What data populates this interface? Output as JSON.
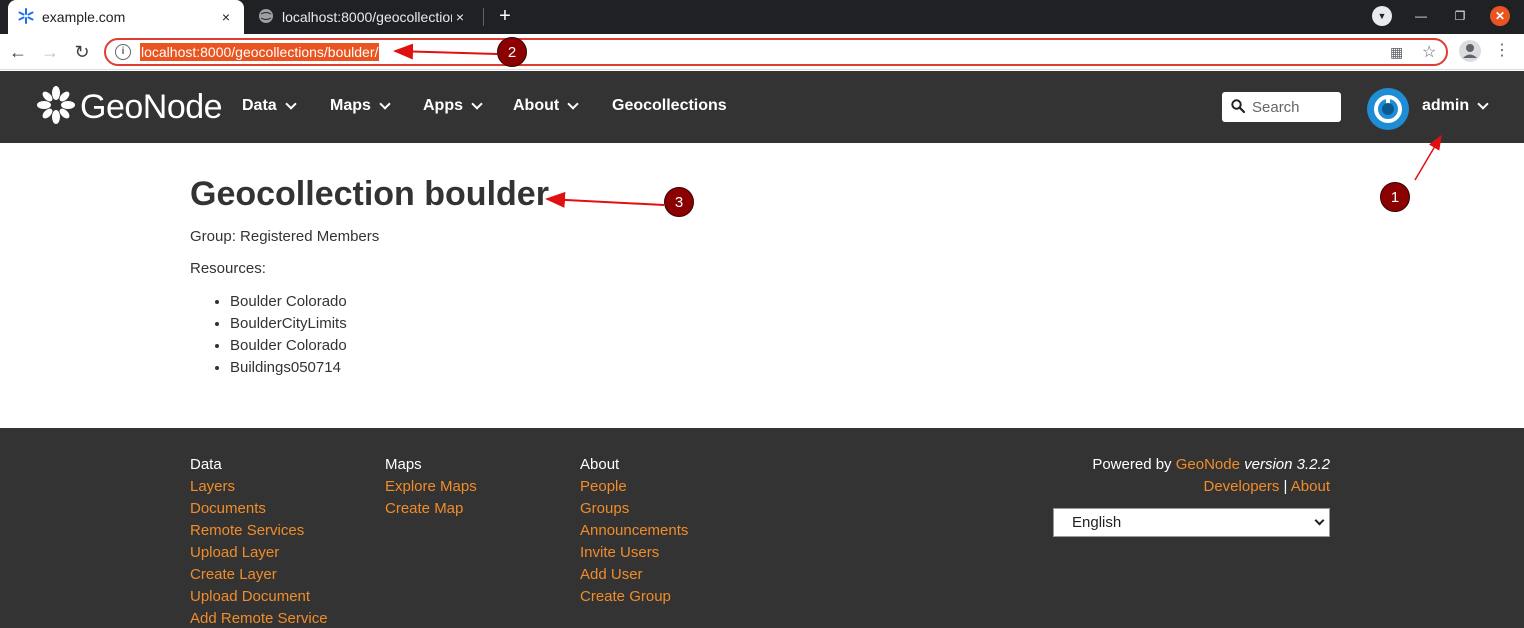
{
  "browser": {
    "tabs": [
      {
        "title": "example.com",
        "close": "×"
      },
      {
        "title": "localhost:8000/geocollections/boulder/",
        "close": "×"
      }
    ],
    "new_tab": "+",
    "url": "localhost:8000/geocollections/boulder/"
  },
  "site": {
    "logo_text": "GeoNode",
    "nav": [
      {
        "label": "Data"
      },
      {
        "label": "Maps"
      },
      {
        "label": "Apps"
      },
      {
        "label": "About"
      },
      {
        "label": "Geocollections"
      }
    ],
    "search_placeholder": "Search",
    "username": "admin"
  },
  "main": {
    "title": "Geocollection boulder",
    "group_line": "Group: Registered Members",
    "resources_heading": "Resources:",
    "resources": [
      "Boulder Colorado",
      "BoulderCityLimits",
      "Boulder Colorado",
      "Buildings050714"
    ]
  },
  "footer": {
    "columns": [
      {
        "heading": "Data",
        "links": [
          "Layers",
          "Documents",
          "Remote Services",
          "Upload Layer",
          "Create Layer",
          "Upload Document",
          "Add Remote Service"
        ]
      },
      {
        "heading": "Maps",
        "links": [
          "Explore Maps",
          "Create Map"
        ]
      },
      {
        "heading": "About",
        "links": [
          "People",
          "Groups",
          "Announcements",
          "Invite Users",
          "Add User",
          "Create Group"
        ]
      }
    ],
    "powered_prefix": "Powered by",
    "powered_brand": "GeoNode",
    "powered_version": "version 3.2.2",
    "developers": "Developers",
    "separator": "|",
    "about": "About",
    "language": "English"
  },
  "annotations": [
    "1",
    "2",
    "3"
  ],
  "colors": {
    "accent": "#f08c2a",
    "header_bg": "#333333",
    "annotation": "#8b0000",
    "highlight": "#e95420"
  }
}
